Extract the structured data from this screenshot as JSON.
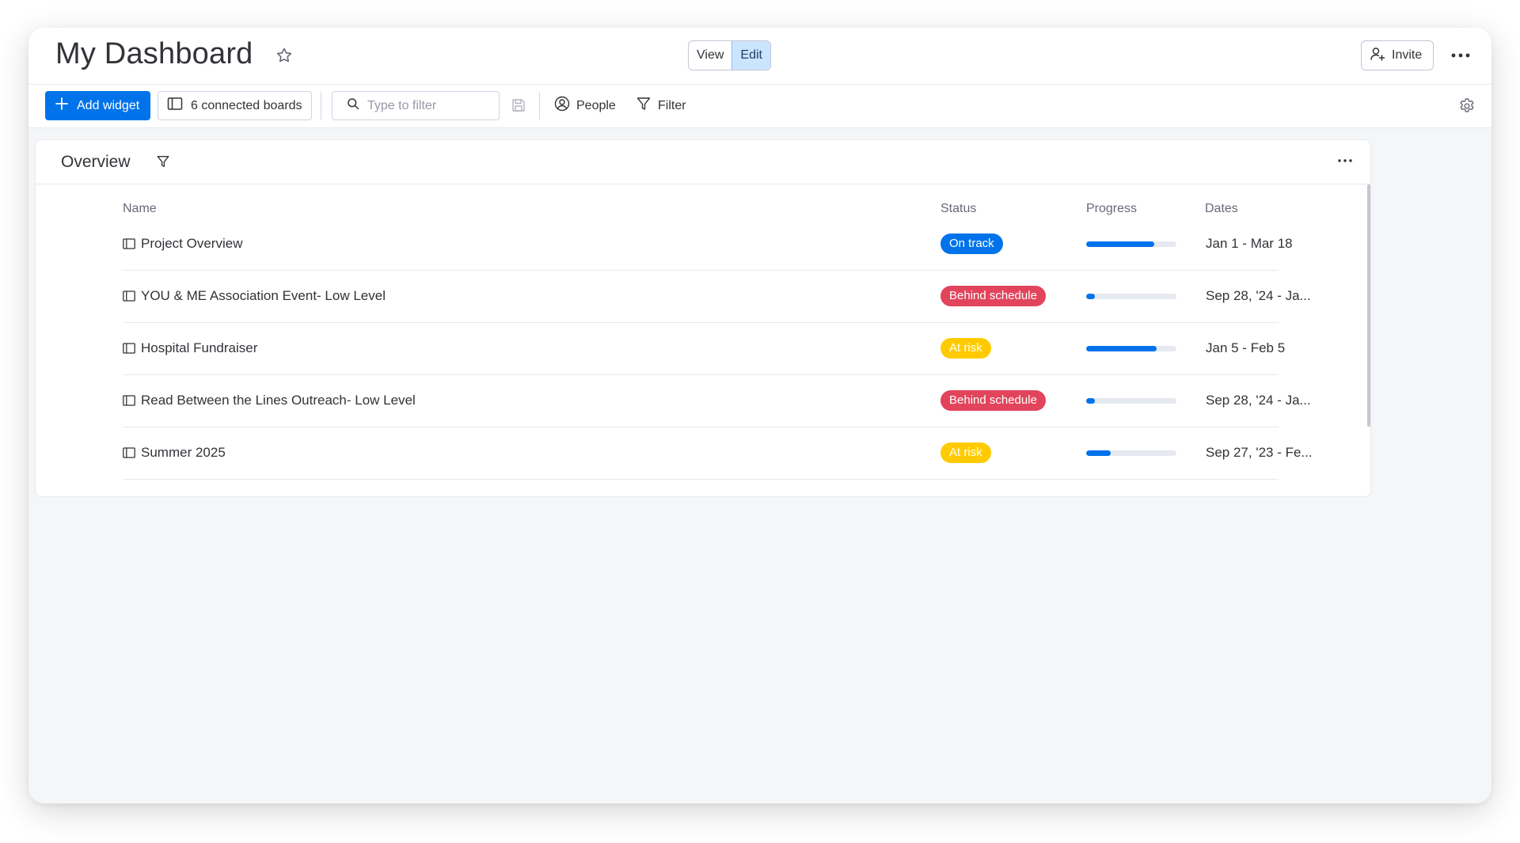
{
  "header": {
    "title": "My Dashboard",
    "view_label": "View",
    "edit_label": "Edit",
    "invite_label": "Invite"
  },
  "toolbar": {
    "add_widget_label": "Add widget",
    "connected_boards_label": "6 connected boards",
    "search_placeholder": "Type to filter",
    "people_label": "People",
    "filter_label": "Filter"
  },
  "widget": {
    "title": "Overview",
    "columns": {
      "name": "Name",
      "status": "Status",
      "progress": "Progress",
      "dates": "Dates"
    },
    "rows": [
      {
        "name": "Project Overview",
        "status": "On track",
        "status_color": "#0073ea",
        "progress": 0.75,
        "dates": "Jan 1 - Mar 18"
      },
      {
        "name": "YOU & ME Association Event- Low Level",
        "status": "Behind schedule",
        "status_color": "#e2445c",
        "progress": 0.1,
        "dates": "Sep 28, '24 - Ja..."
      },
      {
        "name": "Hospital Fundraiser",
        "status": "At risk",
        "status_color": "#ffcb00",
        "progress": 0.78,
        "dates": "Jan 5 - Feb 5"
      },
      {
        "name": "Read Between the Lines Outreach- Low Level",
        "status": "Behind schedule",
        "status_color": "#e2445c",
        "progress": 0.1,
        "dates": "Sep 28, '24 - Ja..."
      },
      {
        "name": "Summer 2025",
        "status": "At risk",
        "status_color": "#ffcb00",
        "progress": 0.27,
        "dates": "Sep 27, '23 - Fe..."
      }
    ]
  },
  "colors": {
    "accent": "#0073ea",
    "edit_active_bg": "#cce5ff",
    "canvas_bg": "#f5f6f8"
  }
}
